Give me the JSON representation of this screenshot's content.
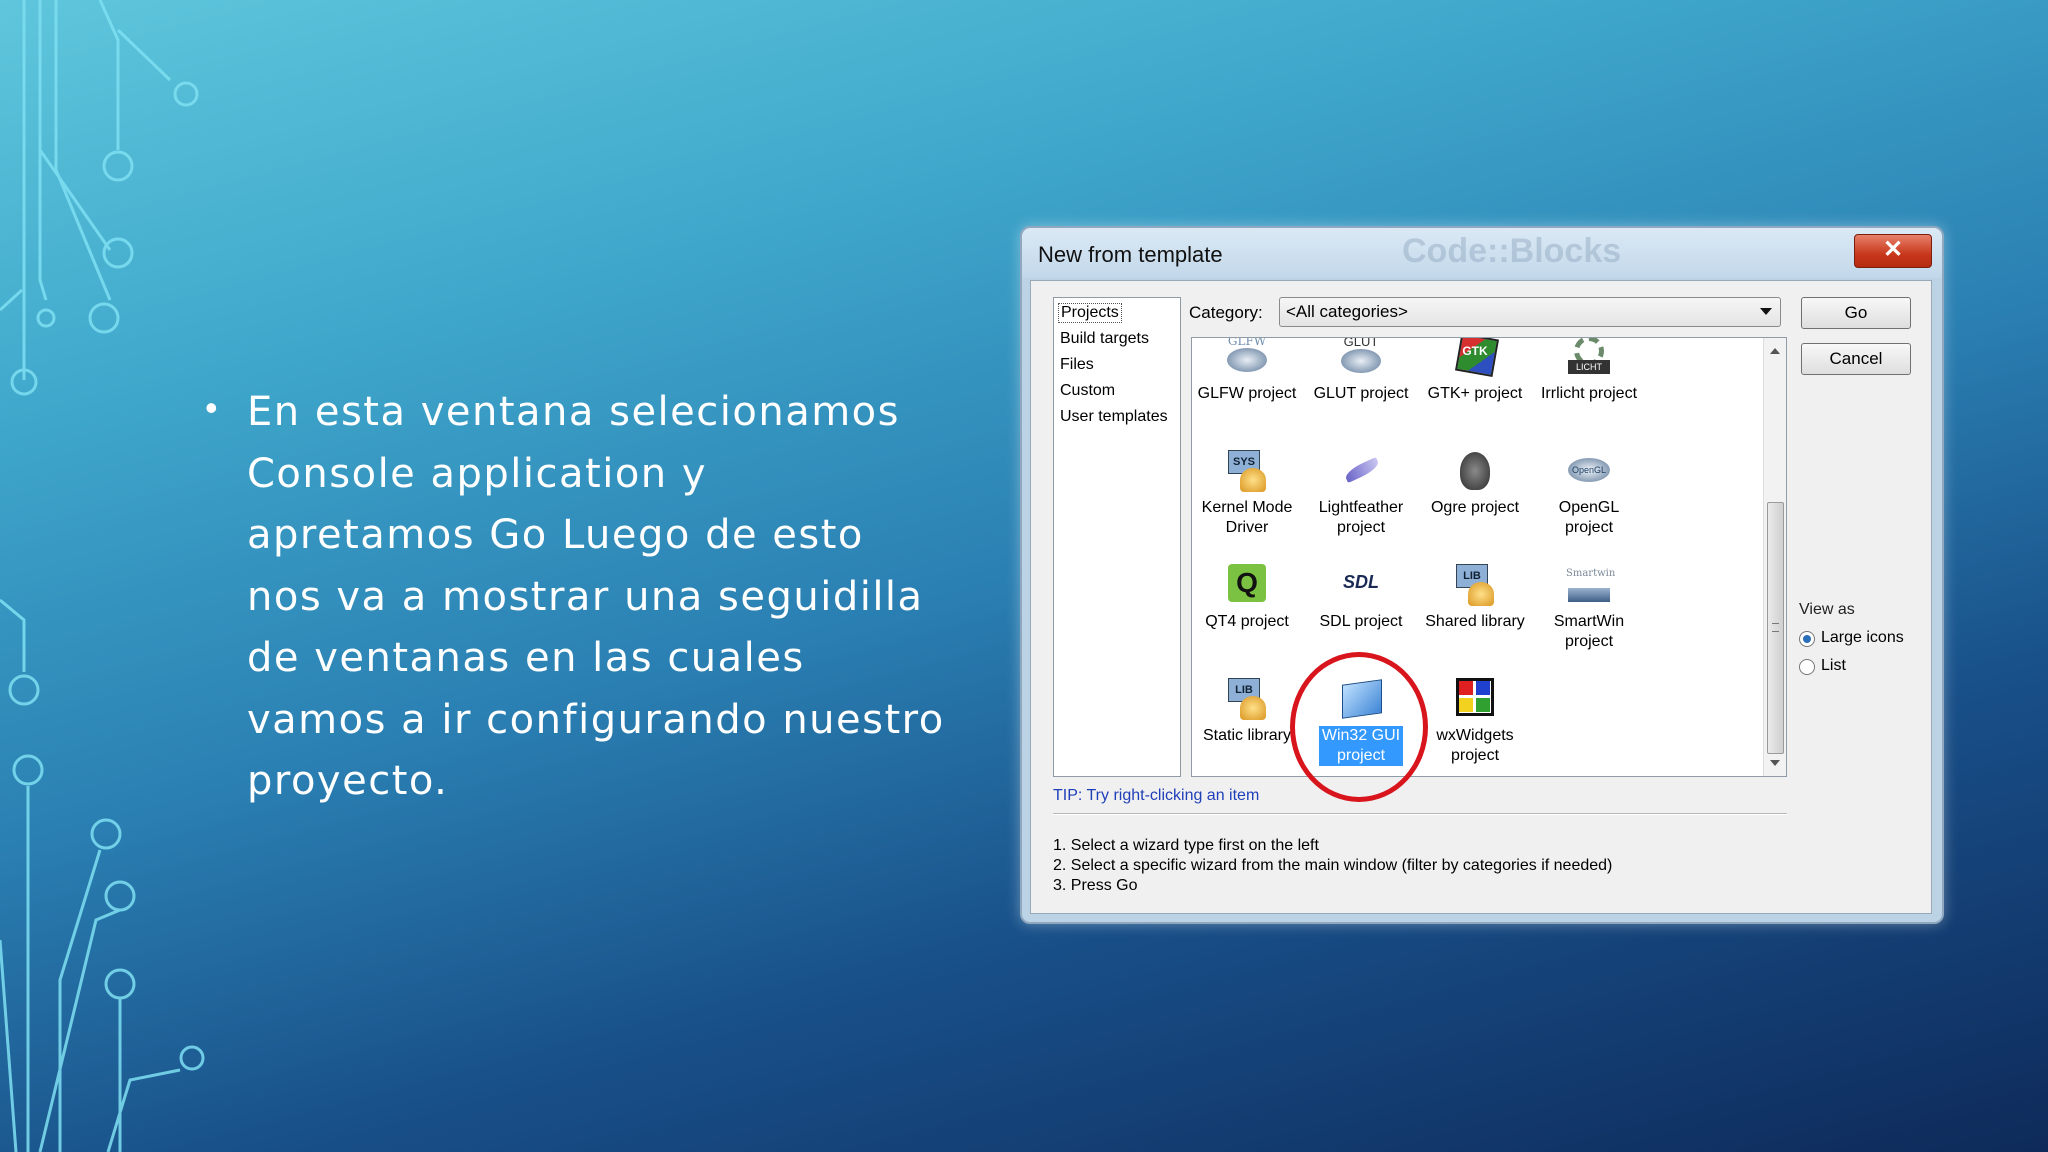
{
  "slide": {
    "bullet": "En esta ventana selecionamos Console application y apretamos Go Luego de esto nos va a mostrar una seguidilla de ventanas en las cuales vamos a ir configurando nuestro proyecto."
  },
  "dialog": {
    "title": "New from template",
    "close_icon": "close-icon",
    "left_list": [
      "Projects",
      "Build targets",
      "Files",
      "Custom",
      "User templates"
    ],
    "selected_left": "Projects",
    "category_label": "Category:",
    "category_value": "<All categories>",
    "go_label": "Go",
    "cancel_label": "Cancel",
    "templates": [
      {
        "label": "GLFW project",
        "icon": "glfw-icon",
        "icon_text": "GLFW"
      },
      {
        "label": "GLUT project",
        "icon": "glut-icon",
        "icon_text": "GLUT"
      },
      {
        "label": "GTK+ project",
        "icon": "gtk-icon",
        "icon_text": "GTK"
      },
      {
        "label": "Irrlicht project",
        "icon": "irrlicht-icon",
        "icon_text": "LICHT"
      },
      {
        "label": "Kernel Mode Driver",
        "icon": "kernel-driver-icon",
        "icon_text": "SYS"
      },
      {
        "label": "Lightfeather project",
        "icon": "lightfeather-icon",
        "icon_text": ""
      },
      {
        "label": "Ogre project",
        "icon": "ogre-icon",
        "icon_text": ""
      },
      {
        "label": "OpenGL project",
        "icon": "opengl-icon",
        "icon_text": "OpenGL"
      },
      {
        "label": "QT4 project",
        "icon": "qt4-icon",
        "icon_text": "Q"
      },
      {
        "label": "SDL project",
        "icon": "sdl-icon",
        "icon_text": "SDL"
      },
      {
        "label": "Shared library",
        "icon": "shared-library-icon",
        "icon_text": "LIB"
      },
      {
        "label": "SmartWin project",
        "icon": "smartwin-icon",
        "icon_text": "Smartwin"
      },
      {
        "label": "Static library",
        "icon": "static-library-icon",
        "icon_text": "LIB"
      },
      {
        "label": "Win32 GUI project",
        "icon": "win32-gui-icon",
        "icon_text": ""
      },
      {
        "label": "wxWidgets project",
        "icon": "wxwidgets-icon",
        "icon_text": ""
      }
    ],
    "selected_template": "Win32 GUI project",
    "tip": "TIP: Try right-clicking an item",
    "instructions": [
      "1. Select a wizard type first on the left",
      "2. Select a specific wizard from the main window (filter by categories if needed)",
      "3. Press Go"
    ],
    "view_as": {
      "title": "View as",
      "options": [
        "Large icons",
        "List"
      ],
      "selected": "Large icons"
    }
  },
  "colors": {
    "highlight": "#d8141c",
    "selection": "#3399ff",
    "tip_text": "#1f3fb8"
  }
}
